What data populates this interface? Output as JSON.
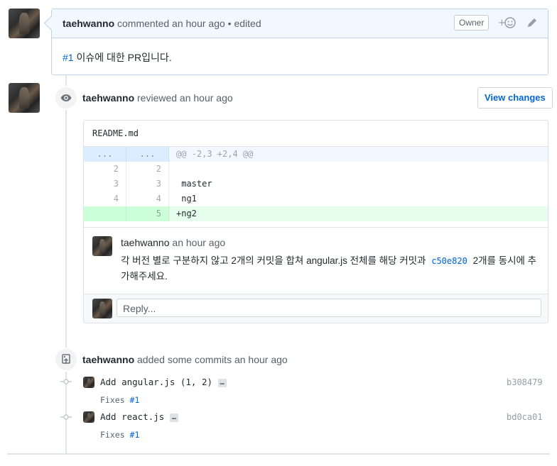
{
  "comment": {
    "author": "taehwanno",
    "action": "commented an hour ago",
    "separator": "•",
    "edited": "edited",
    "owner_badge": "Owner",
    "body_ref": "#1",
    "body_text": " 이슈에 대한 PR입니다."
  },
  "review": {
    "author": "taehwanno",
    "action": "reviewed an hour ago",
    "view_changes_label": "View changes",
    "file_name": "README.md",
    "hunk_dots_left": "...",
    "hunk_dots_right": "...",
    "hunk_header": "@@ -2,3 +2,4 @@",
    "lines": [
      {
        "old": "2",
        "new": "2",
        "code": " "
      },
      {
        "old": "3",
        "new": "3",
        "code": " master"
      },
      {
        "old": "4",
        "new": "4",
        "code": " ng1"
      },
      {
        "old": "",
        "new": "5",
        "code": "+ng2"
      }
    ],
    "inline_comment": {
      "author": "taehwanno",
      "time": "an hour ago",
      "text_before": "각 버전 별로 구분하지 않고 2개의 커밋을 합쳐 angular.js 전체를 해당 커밋과 ",
      "sha": "c50e820",
      "text_after": " 2개를 동시에 추",
      "text_line2": "가해주세요."
    },
    "reply_placeholder": "Reply..."
  },
  "commits_event": {
    "author": "taehwanno",
    "action": "added some commits an hour ago",
    "commits": [
      {
        "message": "Add angular.js (1, 2)",
        "more": "…",
        "sha": "b308479",
        "desc_prefix": "Fixes ",
        "desc_ref": "#1"
      },
      {
        "message": "Add react.js",
        "more": "…",
        "sha": "bd0ca01",
        "desc_prefix": "Fixes ",
        "desc_ref": "#1"
      }
    ]
  },
  "colors": {
    "link": "#0366d6",
    "added_line_bg": "#e6ffed",
    "comment_header_bg": "#f1f8ff"
  }
}
